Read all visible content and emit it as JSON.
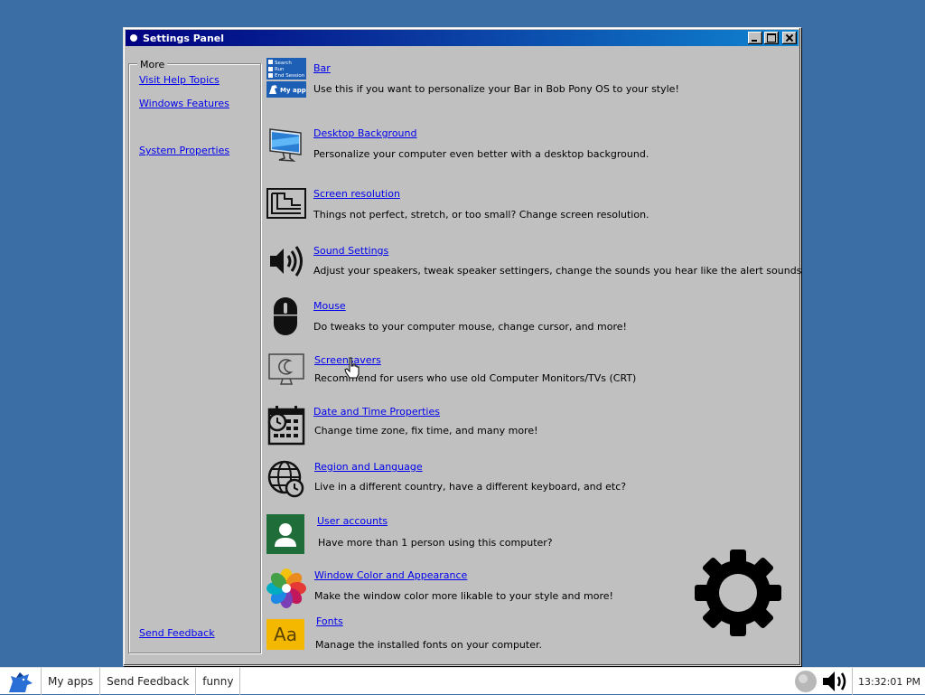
{
  "window": {
    "title": "Settings Panel"
  },
  "sidebar": {
    "legend": "More",
    "links": [
      {
        "label": "Visit Help Topics"
      },
      {
        "label": "Windows Features"
      },
      {
        "label": "System Properties"
      },
      {
        "label": "Send Feedback"
      }
    ]
  },
  "icon_texts": {
    "bar_icon_lines": [
      "Search",
      "Run",
      "End Session",
      "My apps"
    ]
  },
  "items": [
    {
      "title": "Bar",
      "description": "Use this if you want to personalize your Bar in Bob Pony OS to your style!",
      "icon": "bar-icon"
    },
    {
      "title": "Desktop Background",
      "description": "Personalize your computer even better with a desktop background.",
      "icon": "desktop-background-icon"
    },
    {
      "title": "Screen resolution",
      "description": "Things not perfect, stretch, or too small? Change screen resolution.",
      "icon": "screen-resolution-icon"
    },
    {
      "title": "Sound Settings",
      "description": "Adjust your speakers, tweak speaker settingers, change the sounds you hear like the alert sounds",
      "icon": "speaker-icon"
    },
    {
      "title": "Mouse",
      "description": "Do tweaks to your computer mouse, change cursor, and more!",
      "icon": "mouse-icon"
    },
    {
      "title": "Screensavers",
      "description": "Recommend for users who use old Computer Monitors/TVs (CRT)",
      "icon": "screensaver-icon"
    },
    {
      "title": "Date and Time Properties",
      "description": "Change time zone, fix time, and many more!",
      "icon": "calendar-clock-icon"
    },
    {
      "title": "Region and Language",
      "description": "Live in a different country, have a different keyboard, and etc?",
      "icon": "globe-clock-icon"
    },
    {
      "title": "User accounts",
      "description": "Have more than 1 person using this computer?",
      "icon": "user-icon"
    },
    {
      "title": "Window Color and Appearance",
      "description": "Make the window color more likable to your style and more!",
      "icon": "color-flower-icon"
    },
    {
      "title": "Fonts",
      "description": "Manage the installed fonts on your computer.",
      "icon": "fonts-icon"
    }
  ],
  "fonts_icon_text": "Aa",
  "taskbar": {
    "items": [
      {
        "label": "My apps"
      },
      {
        "label": "Send Feedback"
      },
      {
        "label": "funny"
      }
    ],
    "clock": "13:32:01 PM"
  },
  "colors": {
    "desktop": "#3a6ea5",
    "titlebar_start": "#000080",
    "titlebar_end": "#1084d0",
    "window_face": "#c0c0c0",
    "link": "#0000ee",
    "user_tile": "#1f6e3a",
    "fonts_tile": "#f5b800"
  }
}
